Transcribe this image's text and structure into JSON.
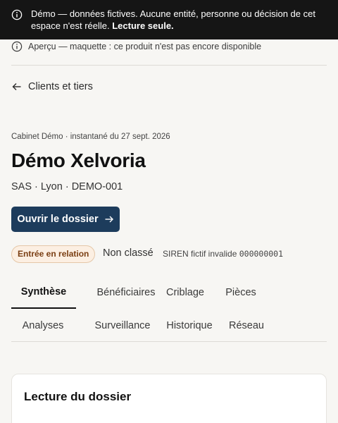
{
  "banner": {
    "icon": "info-icon",
    "text": "Démo — données fictives. Aucune entité, personne ou décision de cet espace n'est réelle.",
    "emphasis": "Lecture seule."
  },
  "preview_notice": {
    "icon": "info-icon",
    "text": "Aperçu — maquette : ce produit n'est pas encore disponible"
  },
  "back_link": {
    "icon": "arrow-left-icon",
    "label": "Clients et tiers"
  },
  "header": {
    "context": "Cabinet Démo · instantané du 27 sept. 2026",
    "title": "Démo Xelvoria",
    "subtitle": "SAS · Lyon · DEMO-001",
    "open_button": "Ouvrir le dossier"
  },
  "status": {
    "badge": "Entrée en relation",
    "risk": "Non classé",
    "siren_label": "SIREN fictif invalide",
    "siren_value": "000000001"
  },
  "tabs": {
    "row1": [
      "Synthèse",
      "Bénéficiaires",
      "Criblage",
      "Pièces"
    ],
    "row2": [
      "Analyses",
      "Surveillance",
      "Historique",
      "Réseau"
    ],
    "active": "Synthèse"
  },
  "card": {
    "title": "Lecture du dossier"
  },
  "colors": {
    "banner_bg": "#151515",
    "accent": "#1d3c5c",
    "badge_bg": "#fcefe2",
    "badge_text": "#7a3e12",
    "page_bg": "#f7f6f3"
  }
}
